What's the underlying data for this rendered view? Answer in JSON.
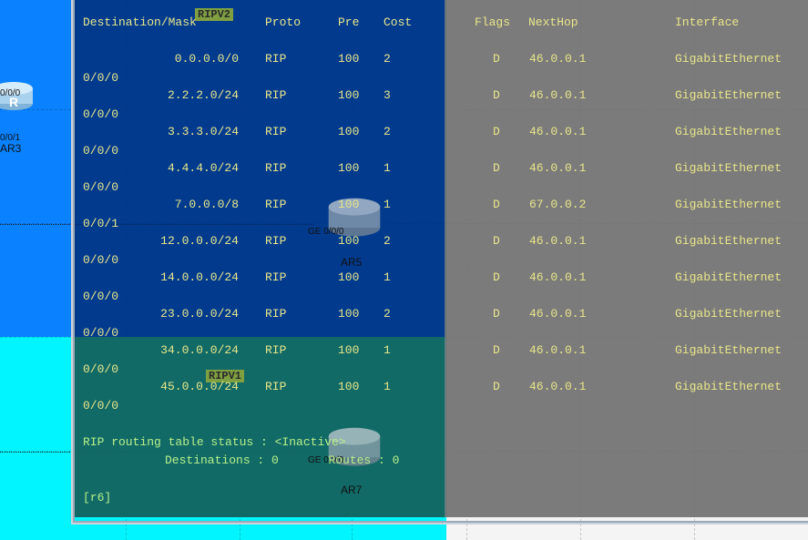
{
  "topology": {
    "areas": [
      {
        "label": "RIPV2"
      },
      {
        "label": "RIPV1"
      }
    ],
    "devices": [
      {
        "name": "AR3",
        "ports": [
          "0/0/0",
          "0/0/1"
        ]
      },
      {
        "name": "AR5",
        "ports": [
          "GE 0/0/0"
        ]
      },
      {
        "name": "AR7",
        "ports": [
          "GE 0/0/0"
        ]
      }
    ]
  },
  "terminal": {
    "headers": {
      "destination": "Destination/Mask",
      "proto": "Proto",
      "pre": "Pre",
      "cost": "Cost",
      "flags": "Flags",
      "nexthop": "NextHop",
      "interface": "Interface"
    },
    "routes": [
      {
        "dest": "0.0.0.0/0",
        "proto": "RIP",
        "pre": "100",
        "cost": "2",
        "flags": "D",
        "nexthop": "46.0.0.1",
        "iface": "GigabitEthernet",
        "port": "0/0/0"
      },
      {
        "dest": "2.2.2.0/24",
        "proto": "RIP",
        "pre": "100",
        "cost": "3",
        "flags": "D",
        "nexthop": "46.0.0.1",
        "iface": "GigabitEthernet",
        "port": "0/0/0"
      },
      {
        "dest": "3.3.3.0/24",
        "proto": "RIP",
        "pre": "100",
        "cost": "2",
        "flags": "D",
        "nexthop": "46.0.0.1",
        "iface": "GigabitEthernet",
        "port": "0/0/0"
      },
      {
        "dest": "4.4.4.0/24",
        "proto": "RIP",
        "pre": "100",
        "cost": "1",
        "flags": "D",
        "nexthop": "46.0.0.1",
        "iface": "GigabitEthernet",
        "port": "0/0/0"
      },
      {
        "dest": "7.0.0.0/8",
        "proto": "RIP",
        "pre": "100",
        "cost": "1",
        "flags": "D",
        "nexthop": "67.0.0.2",
        "iface": "GigabitEthernet",
        "port": "0/0/1"
      },
      {
        "dest": "12.0.0.0/24",
        "proto": "RIP",
        "pre": "100",
        "cost": "2",
        "flags": "D",
        "nexthop": "46.0.0.1",
        "iface": "GigabitEthernet",
        "port": "0/0/0"
      },
      {
        "dest": "14.0.0.0/24",
        "proto": "RIP",
        "pre": "100",
        "cost": "1",
        "flags": "D",
        "nexthop": "46.0.0.1",
        "iface": "GigabitEthernet",
        "port": "0/0/0"
      },
      {
        "dest": "23.0.0.0/24",
        "proto": "RIP",
        "pre": "100",
        "cost": "2",
        "flags": "D",
        "nexthop": "46.0.0.1",
        "iface": "GigabitEthernet",
        "port": "0/0/0"
      },
      {
        "dest": "34.0.0.0/24",
        "proto": "RIP",
        "pre": "100",
        "cost": "1",
        "flags": "D",
        "nexthop": "46.0.0.1",
        "iface": "GigabitEthernet",
        "port": "0/0/0"
      },
      {
        "dest": "45.0.0.0/24",
        "proto": "RIP",
        "pre": "100",
        "cost": "1",
        "flags": "D",
        "nexthop": "46.0.0.1",
        "iface": "GigabitEthernet",
        "port": "0/0/0"
      }
    ],
    "status_line": "RIP routing table status : <Inactive>",
    "destinations_line": "Destinations : 0       Routes : 0",
    "prompt": "[r6]"
  },
  "colors": {
    "topology_blue": "#0a82ff",
    "topology_cyan": "#00f5ff",
    "terminal_text": "#e8e68a",
    "area_label_bg": "#7fa040"
  }
}
